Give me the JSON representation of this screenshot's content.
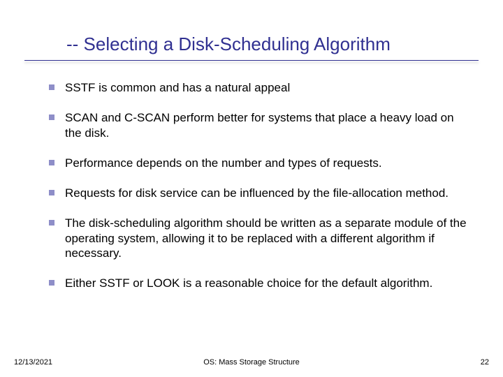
{
  "title": "-- Selecting a Disk-Scheduling Algorithm",
  "bullets": [
    "SSTF is common and has a natural appeal",
    "SCAN and C-SCAN perform better for systems that place a heavy load on the disk.",
    "Performance depends on the number and types of requests.",
    "Requests for disk service can be influenced by the file-allocation method.",
    "The disk-scheduling algorithm should be written as a separate module of the operating system, allowing it to be replaced with a different algorithm if necessary.",
    "Either SSTF or LOOK is a reasonable choice for the default algorithm."
  ],
  "footer": {
    "date": "12/13/2021",
    "center": "OS: Mass Storage Structure",
    "page": "22"
  }
}
